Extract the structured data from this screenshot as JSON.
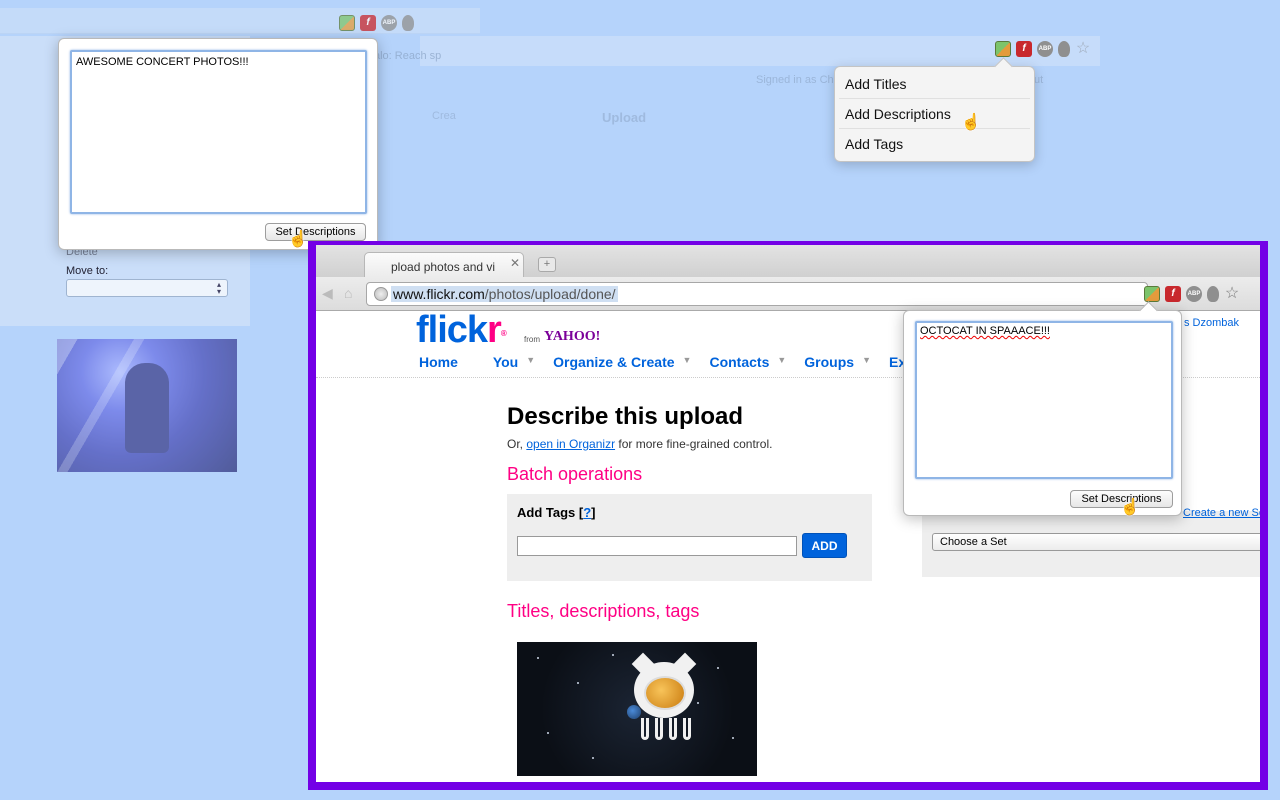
{
  "background_browser": {
    "header_text": "alo: Reach sp",
    "signed_in_text": "Signed in as Chr",
    "signout_text": "ut",
    "faded_links": [
      "Crea",
      "Upload"
    ],
    "delete_label": "Delete",
    "move_to_label": "Move to:"
  },
  "popup_left": {
    "textarea_value": "AWESOME CONCERT PHOTOS!!!",
    "button_label": "Set Descriptions"
  },
  "menu": {
    "items": [
      {
        "label": "Add Titles"
      },
      {
        "label": "Add Descriptions"
      },
      {
        "label": "Add Tags"
      }
    ]
  },
  "browser": {
    "tab_title": "pload photos and vi",
    "url_host": "www.flickr.com",
    "url_path": "/photos/upload/done/"
  },
  "flickr": {
    "logo_flick": "flick",
    "logo_r": "r",
    "logo_from": "from",
    "logo_yahoo": "YAHOO!",
    "user_name": "s Dzombak",
    "nav": [
      "Home",
      "You",
      "Organize & Create",
      "Contacts",
      "Groups",
      "Explor"
    ],
    "heading": "Describe this upload",
    "sub_prefix": "Or, ",
    "sub_link": "open in Organizr",
    "sub_suffix": " for more fine-grained control.",
    "batch_heading": "Batch operations",
    "add_tags_label": "Add Tags",
    "help_link": "?",
    "add_button": "ADD",
    "titles_heading": "Titles, descriptions, tags",
    "create_set_link": "Create a new Se",
    "choose_set": "Choose a Set"
  },
  "popup_main": {
    "textarea_value": "OCTOCAT IN SPAAACE!!!",
    "button_label": "Set Descriptions"
  },
  "colors": {
    "frame": "#7300e6",
    "flickr_blue": "#0063dc",
    "flickr_pink": "#ff0084"
  }
}
